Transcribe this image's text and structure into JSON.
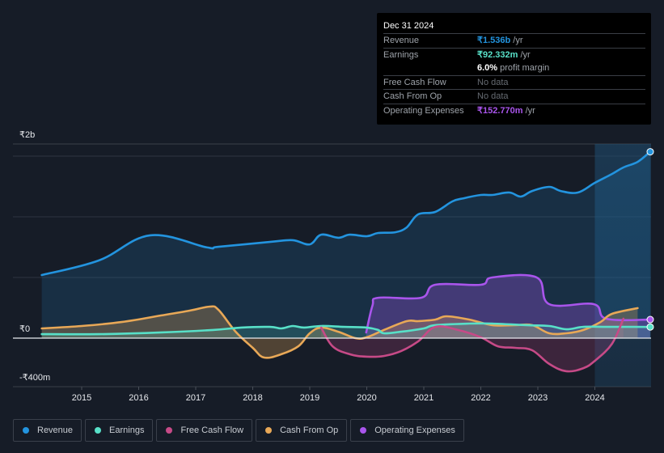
{
  "tooltip": {
    "date": "Dec 31 2024",
    "rows": [
      {
        "key": "Revenue",
        "value": "₹1.536b",
        "unit": " /yr",
        "color": "#2394df"
      },
      {
        "key": "Earnings",
        "value": "₹92.332m",
        "unit": " /yr",
        "color": "#58e0c8"
      },
      {
        "key": "",
        "value": "6.0%",
        "unit": " profit margin",
        "color": "#ffffff"
      },
      {
        "key": "Free Cash Flow",
        "nodata": "No data"
      },
      {
        "key": "Cash From Op",
        "nodata": "No data"
      },
      {
        "key": "Operating Expenses",
        "value": "₹152.770m",
        "unit": " /yr",
        "color": "#a955ec"
      }
    ]
  },
  "legend": [
    {
      "label": "Revenue",
      "color": "#2394df"
    },
    {
      "label": "Earnings",
      "color": "#58e0c8"
    },
    {
      "label": "Free Cash Flow",
      "color": "#c64a87"
    },
    {
      "label": "Cash From Op",
      "color": "#e8a857"
    },
    {
      "label": "Operating Expenses",
      "color": "#a955ec"
    }
  ],
  "chart_data": {
    "type": "area",
    "title": "",
    "xlabel": "",
    "ylabel": "",
    "unit": "INR millions",
    "ylim": [
      -400,
      2000
    ],
    "y_tick_labels": [
      {
        "value": 2000,
        "label": "₹2b"
      },
      {
        "value": 0,
        "label": "₹0"
      },
      {
        "value": -400,
        "label": "-₹400m"
      }
    ],
    "gridlines": [
      1500,
      1000,
      500
    ],
    "x_ticks": [
      2015,
      2016,
      2017,
      2018,
      2019,
      2020,
      2021,
      2022,
      2023,
      2024
    ],
    "xlim": [
      2013.7,
      2025.0
    ],
    "highlight_from": 2024.0,
    "legend_position": "bottom",
    "series": [
      {
        "name": "Revenue",
        "color": "#2394df",
        "points": [
          [
            2014.3,
            520
          ],
          [
            2015.3,
            640
          ],
          [
            2016.2,
            847
          ],
          [
            2017.2,
            747
          ],
          [
            2017.4,
            753
          ],
          [
            2018.3,
            793
          ],
          [
            2018.7,
            807
          ],
          [
            2019.0,
            773
          ],
          [
            2019.2,
            853
          ],
          [
            2019.5,
            827
          ],
          [
            2019.7,
            853
          ],
          [
            2020.0,
            840
          ],
          [
            2020.2,
            867
          ],
          [
            2020.5,
            873
          ],
          [
            2020.7,
            913
          ],
          [
            2020.9,
            1020
          ],
          [
            2021.2,
            1040
          ],
          [
            2021.5,
            1127
          ],
          [
            2021.7,
            1153
          ],
          [
            2022.0,
            1180
          ],
          [
            2022.2,
            1180
          ],
          [
            2022.5,
            1200
          ],
          [
            2022.7,
            1167
          ],
          [
            2022.9,
            1213
          ],
          [
            2023.2,
            1247
          ],
          [
            2023.4,
            1213
          ],
          [
            2023.7,
            1200
          ],
          [
            2024.0,
            1280
          ],
          [
            2024.3,
            1353
          ],
          [
            2024.5,
            1407
          ],
          [
            2024.75,
            1453
          ],
          [
            2024.97,
            1536
          ]
        ]
      },
      {
        "name": "Earnings",
        "color": "#58e0c8",
        "points": [
          [
            2014.3,
            33
          ],
          [
            2015.3,
            33
          ],
          [
            2016.4,
            47
          ],
          [
            2017.3,
            67
          ],
          [
            2017.8,
            87
          ],
          [
            2018.3,
            93
          ],
          [
            2018.5,
            80
          ],
          [
            2018.7,
            100
          ],
          [
            2018.9,
            87
          ],
          [
            2019.2,
            100
          ],
          [
            2019.6,
            93
          ],
          [
            2020.0,
            87
          ],
          [
            2020.2,
            67
          ],
          [
            2020.3,
            40
          ],
          [
            2020.6,
            53
          ],
          [
            2021.0,
            80
          ],
          [
            2021.2,
            107
          ],
          [
            2021.8,
            120
          ],
          [
            2022.2,
            120
          ],
          [
            2022.8,
            107
          ],
          [
            2023.2,
            100
          ],
          [
            2023.5,
            73
          ],
          [
            2023.8,
            93
          ],
          [
            2024.2,
            93
          ],
          [
            2024.6,
            93
          ],
          [
            2024.97,
            92
          ]
        ]
      },
      {
        "name": "Free Cash Flow",
        "color": "#c64a87",
        "points": [
          [
            2019.2,
            87
          ],
          [
            2019.4,
            -67
          ],
          [
            2019.7,
            -133
          ],
          [
            2020.0,
            -153
          ],
          [
            2020.3,
            -147
          ],
          [
            2020.6,
            -107
          ],
          [
            2020.9,
            -27
          ],
          [
            2021.2,
            93
          ],
          [
            2021.6,
            67
          ],
          [
            2022.0,
            7
          ],
          [
            2022.3,
            -67
          ],
          [
            2022.6,
            -80
          ],
          [
            2022.9,
            -100
          ],
          [
            2023.2,
            -213
          ],
          [
            2023.5,
            -273
          ],
          [
            2023.8,
            -247
          ],
          [
            2024.0,
            -187
          ],
          [
            2024.3,
            -47
          ],
          [
            2024.5,
            160
          ]
        ]
      },
      {
        "name": "Cash From Op",
        "color": "#e8a857",
        "points": [
          [
            2014.3,
            80
          ],
          [
            2015.0,
            100
          ],
          [
            2015.7,
            133
          ],
          [
            2016.4,
            187
          ],
          [
            2016.9,
            227
          ],
          [
            2017.25,
            260
          ],
          [
            2017.4,
            233
          ],
          [
            2017.7,
            53
          ],
          [
            2018.0,
            -80
          ],
          [
            2018.2,
            -160
          ],
          [
            2018.5,
            -133
          ],
          [
            2018.8,
            -67
          ],
          [
            2019.0,
            40
          ],
          [
            2019.2,
            87
          ],
          [
            2019.5,
            53
          ],
          [
            2019.8,
            0
          ],
          [
            2020.0,
            7
          ],
          [
            2020.3,
            67
          ],
          [
            2020.7,
            140
          ],
          [
            2020.9,
            140
          ],
          [
            2021.2,
            153
          ],
          [
            2021.4,
            180
          ],
          [
            2021.8,
            153
          ],
          [
            2022.2,
            107
          ],
          [
            2022.6,
            107
          ],
          [
            2022.9,
            107
          ],
          [
            2023.2,
            40
          ],
          [
            2023.5,
            40
          ],
          [
            2023.8,
            67
          ],
          [
            2024.1,
            133
          ],
          [
            2024.3,
            200
          ],
          [
            2024.75,
            247
          ]
        ]
      },
      {
        "name": "Operating Expenses",
        "color": "#a955ec",
        "points": [
          [
            2019.99,
            47
          ],
          [
            2020.1,
            267
          ],
          [
            2020.2,
            333
          ],
          [
            2020.95,
            333
          ],
          [
            2021.2,
            440
          ],
          [
            2022.0,
            440
          ],
          [
            2022.2,
            500
          ],
          [
            2022.98,
            500
          ],
          [
            2023.2,
            280
          ],
          [
            2023.98,
            280
          ],
          [
            2024.2,
            160
          ],
          [
            2024.97,
            153
          ]
        ]
      }
    ]
  }
}
